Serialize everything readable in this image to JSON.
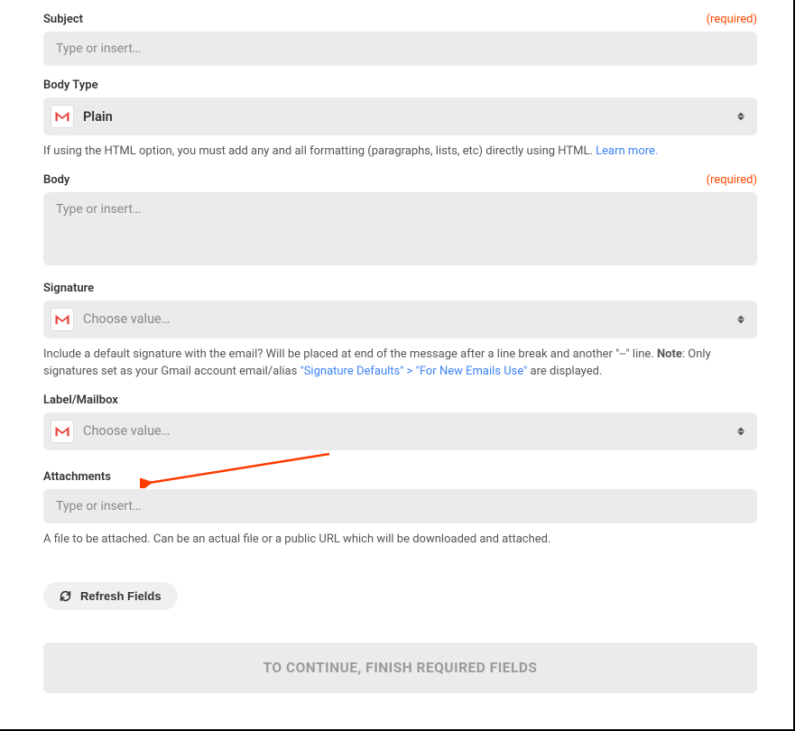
{
  "fields": {
    "subject": {
      "label": "Subject",
      "required": "(required)",
      "placeholder": "Type or insert…"
    },
    "bodyType": {
      "label": "Body Type",
      "value": "Plain",
      "help_prefix": "If using the HTML option, you must add any and all formatting (paragraphs, lists, etc) directly using HTML. ",
      "help_link": "Learn more."
    },
    "body": {
      "label": "Body",
      "required": "(required)",
      "placeholder": "Type or insert…"
    },
    "signature": {
      "label": "Signature",
      "placeholder": "Choose value…",
      "help_prefix": "Include a default signature with the email? Will be placed at end of the message after a line break and another \"--\" line. ",
      "help_note_label": "Note",
      "help_note_text": ": Only signatures set as your Gmail account email/alias ",
      "help_link": "\"Signature Defaults\" > \"For New Emails Use\"",
      "help_suffix": " are displayed."
    },
    "labelMailbox": {
      "label": "Label/Mailbox",
      "placeholder": "Choose value…"
    },
    "attachments": {
      "label": "Attachments",
      "placeholder": "Type or insert…",
      "help": "A file to be attached. Can be an actual file or a public URL which will be downloaded and attached."
    }
  },
  "buttons": {
    "refresh": "Refresh Fields",
    "continue": "To continue, finish required fields"
  }
}
